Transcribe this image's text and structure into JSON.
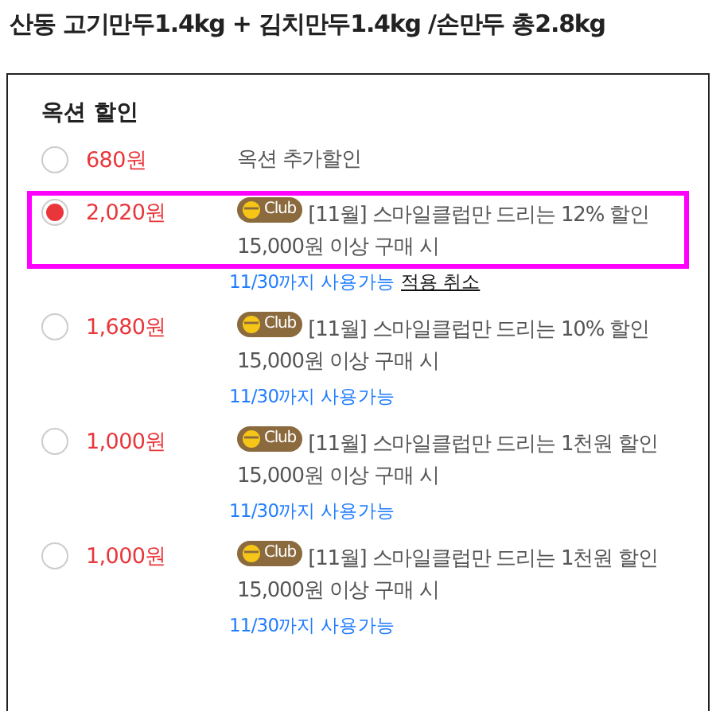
{
  "product_title": "산동 고기만두1.4kg + 김치만두1.4kg /손만두 총2.8kg",
  "panel": {
    "heading": "옥션 할인",
    "options": [
      {
        "price": "680원",
        "selected": false,
        "title": "옥션 추가할인"
      },
      {
        "price": "2,020원",
        "selected": true,
        "badge": "Club",
        "title": "[11월] 스마일클럽만 드리는 12% 할인",
        "condition": "15,000원 이상 구매 시",
        "expiry": "11/30까지 사용가능",
        "action": "적용 취소"
      },
      {
        "price": "1,680원",
        "selected": false,
        "badge": "Club",
        "title": "[11월] 스마일클럽만 드리는 10% 할인",
        "condition": "15,000원 이상 구매 시",
        "expiry": "11/30까지 사용가능"
      },
      {
        "price": "1,000원",
        "selected": false,
        "badge": "Club",
        "title": "[11월] 스마일클럽만 드리는 1천원 할인",
        "condition": "15,000원 이상 구매 시",
        "expiry": "11/30까지 사용가능"
      },
      {
        "price": "1,000원",
        "selected": false,
        "badge": "Club",
        "title": "[11월] 스마일클럽만 드리는 1천원 할인",
        "condition": "15,000원 이상 구매 시",
        "expiry": "11/30까지 사용가능"
      }
    ]
  }
}
